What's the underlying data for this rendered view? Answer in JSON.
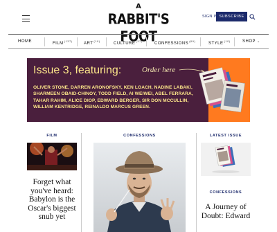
{
  "header": {
    "logo_top": "A",
    "logo_main": "RABBIT'S FOOT",
    "signin_label": "SIGN IN",
    "subscribe_label": "SUBSCRIBE",
    "menu_icon": "hamburger-icon",
    "search_icon": "search-icon"
  },
  "nav": {
    "items": [
      {
        "label": "HOME",
        "count": ""
      },
      {
        "label": "FILM",
        "count": "(137)"
      },
      {
        "label": "ART",
        "count": "(19)"
      },
      {
        "label": "CULTURE",
        "count": "(37)"
      },
      {
        "label": "CONFESSIONS",
        "count": "(69)"
      },
      {
        "label": "STYLE",
        "count": "(10)"
      },
      {
        "label": "SHOP",
        "count": ""
      }
    ]
  },
  "banner": {
    "heading": "Issue 3, featuring:",
    "cta": "Order here",
    "names": "OLIVER STONE, DARREN ARONOFSKY, KEN LOACH, NADINE LABAKI, SHARMEEN OBAID-CHINOY, TODD FIELD, AI WEIWEI, ABEL FERRARA, TAHAR RAHIM, ALICE DIOP, EDWARD BERGER, SIR DON MCCULLIN, WILLIAM KENTRIDGE, REINALDO MARCUS GREEN.",
    "colors": {
      "background": "#4a1f3d",
      "accent": "#ff7a1f",
      "text": "#fde68a"
    }
  },
  "columns": {
    "film": {
      "label": "FILM",
      "headline": "Forget what you've heard: Babylon is the Oscar's biggest snub yet"
    },
    "confessions_feature": {
      "label": "CONFESSIONS"
    },
    "latest": {
      "label": "LATEST ISSUE",
      "confessions_label": "CONFESSIONS",
      "headline": "A Journey of Doubt: Edward"
    }
  },
  "colors": {
    "brand_navy": "#1c2a6b"
  }
}
